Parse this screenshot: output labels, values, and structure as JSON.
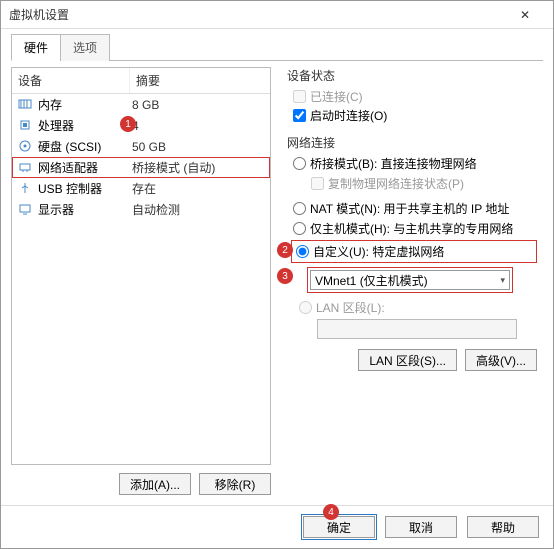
{
  "window": {
    "title": "虚拟机设置"
  },
  "tabs": {
    "hardware": "硬件",
    "options": "选项"
  },
  "hw_header": {
    "device": "设备",
    "summary": "摘要"
  },
  "hw": [
    {
      "name": "内存",
      "summary": "8 GB"
    },
    {
      "name": "处理器",
      "summary": "4"
    },
    {
      "name": "硬盘 (SCSI)",
      "summary": "50 GB"
    },
    {
      "name": "网络适配器",
      "summary": "桥接模式 (自动)"
    },
    {
      "name": "USB 控制器",
      "summary": "存在"
    },
    {
      "name": "显示器",
      "summary": "自动检测"
    }
  ],
  "left_buttons": {
    "add": "添加(A)...",
    "remove": "移除(R)"
  },
  "right": {
    "status_title": "设备状态",
    "connected": "已连接(C)",
    "connect_at_power": "启动时连接(O)",
    "net_title": "网络连接",
    "bridged": "桥接模式(B): 直接连接物理网络",
    "replicate": "复制物理网络连接状态(P)",
    "nat": "NAT 模式(N): 用于共享主机的 IP 地址",
    "hostonly": "仅主机模式(H): 与主机共享的专用网络",
    "custom": "自定义(U): 特定虚拟网络",
    "custom_select": "VMnet1 (仅主机模式)",
    "lan": "LAN 区段(L):",
    "lan_btn": "LAN 区段(S)...",
    "adv_btn": "高级(V)..."
  },
  "footer": {
    "ok": "确定",
    "cancel": "取消",
    "help": "帮助"
  },
  "annotations": {
    "n1": "1",
    "n2": "2",
    "n3": "3",
    "n4": "4"
  }
}
